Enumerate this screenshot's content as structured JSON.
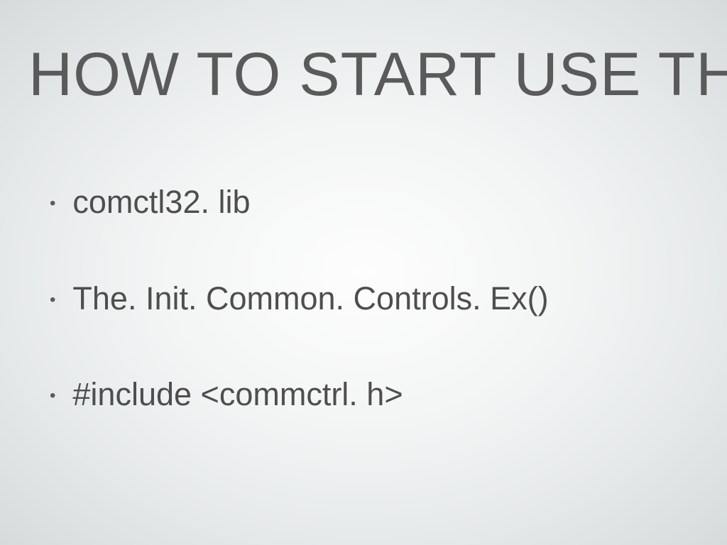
{
  "slide": {
    "title": "HOW TO START USE THEM",
    "bullets": [
      "comctl32. lib",
      "The. Init. Common. Controls. Ex()",
      "#include <commctrl. h>"
    ]
  }
}
